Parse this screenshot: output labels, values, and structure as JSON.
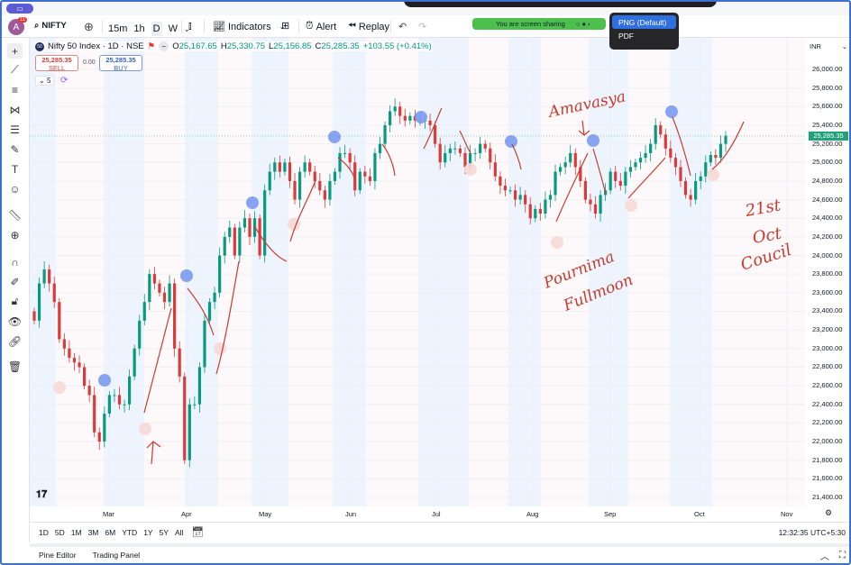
{
  "topbar": {
    "screen_icon": "screen-share-icon"
  },
  "toolbar": {
    "avatar_letter": "A",
    "notification_count": "11",
    "symbol": "NIFTY",
    "intervals": [
      "15m",
      "1h",
      "D",
      "W"
    ],
    "active_interval": "D",
    "indicators_label": "Indicators",
    "alert_label": "Alert",
    "replay_label": "Replay"
  },
  "screen_share": {
    "text": "You are screen sharing"
  },
  "export_menu": {
    "items": [
      "PNG (Default)",
      "PDF"
    ],
    "selected": "PNG (Default)"
  },
  "legend": {
    "badge": "50",
    "title": "Nifty 50 Index · 1D · NSE",
    "open_label": "O",
    "open": "25,167.65",
    "high_label": "H",
    "high": "25,330.75",
    "low_label": "L",
    "low": "25,156.85",
    "close_label": "C",
    "close": "25,285.35",
    "change": "+103.55 (+0.41%)",
    "sell_price": "25,285.35",
    "sell_label": "SELL",
    "spread": "0.00",
    "buy_price": "25,285.35",
    "buy_label": "BUY",
    "indicators_count": "5"
  },
  "price_axis": {
    "currency": "INR",
    "labels": [
      "26,000.00",
      "25,800.00",
      "25,600.00",
      "25,400.00",
      "25,200.00",
      "25,000.00",
      "24,800.00",
      "24,600.00",
      "24,400.00",
      "24,200.00",
      "24,000.00",
      "23,800.00",
      "23,600.00",
      "23,400.00",
      "23,200.00",
      "23,000.00",
      "22,800.00",
      "22,600.00",
      "22,400.00",
      "22,200.00",
      "22,000.00",
      "21,800.00",
      "21,600.00",
      "21,400.00"
    ],
    "current_price": "25,285.35"
  },
  "time_axis": {
    "labels": [
      "Mar",
      "Apr",
      "May",
      "Jun",
      "Jul",
      "Aug",
      "Sep",
      "Oct",
      "Nov"
    ]
  },
  "range_bar": {
    "ranges": [
      "1D",
      "5D",
      "1M",
      "3M",
      "6M",
      "YTD",
      "1Y",
      "5Y",
      "All"
    ],
    "clock": "12:32:35 UTC+5:30"
  },
  "bottom_panel": {
    "tabs": [
      "Pine Editor",
      "Trading Panel"
    ]
  },
  "annotations": {
    "amavasya": "Amavasya",
    "pournima": "Pournima",
    "fullmoon": "Fullmoon",
    "date_line1": "21st",
    "date_line2": "Oct",
    "date_line3": "Coucil"
  },
  "colors": {
    "up": "#089981",
    "down": "#d93b3b",
    "new_moon_marker": "#7b9af0",
    "full_moon_marker": "#f6d9d6",
    "annotation": "#c93a2e"
  },
  "chart_data": {
    "type": "candlestick",
    "symbol": "Nifty 50 Index",
    "timeframe": "1D",
    "ylim": [
      21400,
      26000
    ],
    "x_tick_labels": [
      "Mar",
      "Apr",
      "May",
      "Jun",
      "Jul",
      "Aug",
      "Sep",
      "Oct",
      "Nov"
    ],
    "first_open": 23400,
    "closes": [
      23300,
      23700,
      23850,
      23700,
      23500,
      23100,
      23000,
      22900,
      22850,
      22800,
      22600,
      22500,
      22100,
      22000,
      22300,
      22500,
      22500,
      22400,
      22400,
      22700,
      23000,
      23300,
      23500,
      23800,
      23700,
      23600,
      23500,
      23700,
      23000,
      22700,
      21800,
      22400,
      22400,
      22800,
      23300,
      23500,
      23600,
      24000,
      24200,
      24300,
      24000,
      24300,
      24400,
      24200,
      24400,
      24000,
      24700,
      24900,
      25000,
      24900,
      25000,
      24800,
      24600,
      24900,
      25000,
      24900,
      24800,
      24700,
      24600,
      24800,
      24900,
      25100,
      25100,
      25000,
      24700,
      24900,
      24850,
      24800,
      25100,
      25200,
      25400,
      25550,
      25600,
      25500,
      25450,
      25500,
      25450,
      25450,
      25450,
      25400,
      25200,
      25000,
      25100,
      25150,
      25150,
      25100,
      24950,
      25100,
      25100,
      25200,
      25150,
      25000,
      24850,
      24750,
      24700,
      24700,
      24600,
      24650,
      24550,
      24400,
      24500,
      24450,
      24600,
      24650,
      24900,
      24950,
      25000,
      25100,
      24950,
      24800,
      24600,
      24550,
      24450,
      24650,
      24700,
      24900,
      24800,
      24750,
      24900,
      24950,
      25000,
      25050,
      25100,
      25200,
      25400,
      25300,
      25150,
      25050,
      24950,
      24800,
      24650,
      24600,
      24800,
      24850,
      25000,
      25080,
      25050,
      25200,
      25285.35
    ],
    "last_close": 25285.35
  }
}
